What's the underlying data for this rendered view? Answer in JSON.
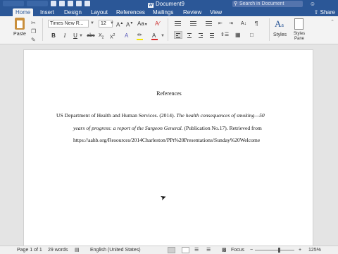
{
  "window": {
    "title": "Document9",
    "search_placeholder": "Search in Document"
  },
  "tabs": [
    {
      "label": "Home",
      "active": true
    },
    {
      "label": "Insert"
    },
    {
      "label": "Design"
    },
    {
      "label": "Layout"
    },
    {
      "label": "References"
    },
    {
      "label": "Mailings"
    },
    {
      "label": "Review"
    },
    {
      "label": "View"
    }
  ],
  "share_label": "Share",
  "ribbon": {
    "paste_label": "Paste",
    "font_name": "Times New R...",
    "font_size": "12",
    "styles_label": "Styles",
    "styles_pane_label": "Styles Pane",
    "highlight_color": "#f4e400",
    "font_color": "#d92b2b"
  },
  "document": {
    "heading": "References",
    "reference": {
      "author_date": "US Department of Health and Human Services. (2014). ",
      "title_part1": "The health consequences of smoking—50",
      "title_part2": "years of progress: a report of the Surgeon General.",
      "after_title": " (Publication No.17).  Retrieved from",
      "url": "https://aahb.org/Resources/2014Charleston/PPt%20Presentations/Sunday%20Welcome"
    }
  },
  "status": {
    "page": "Page 1 of 1",
    "words": "29 words",
    "language": "English (United States)",
    "focus": "Focus",
    "zoom": "125%",
    "zoom_level": 0.6
  }
}
